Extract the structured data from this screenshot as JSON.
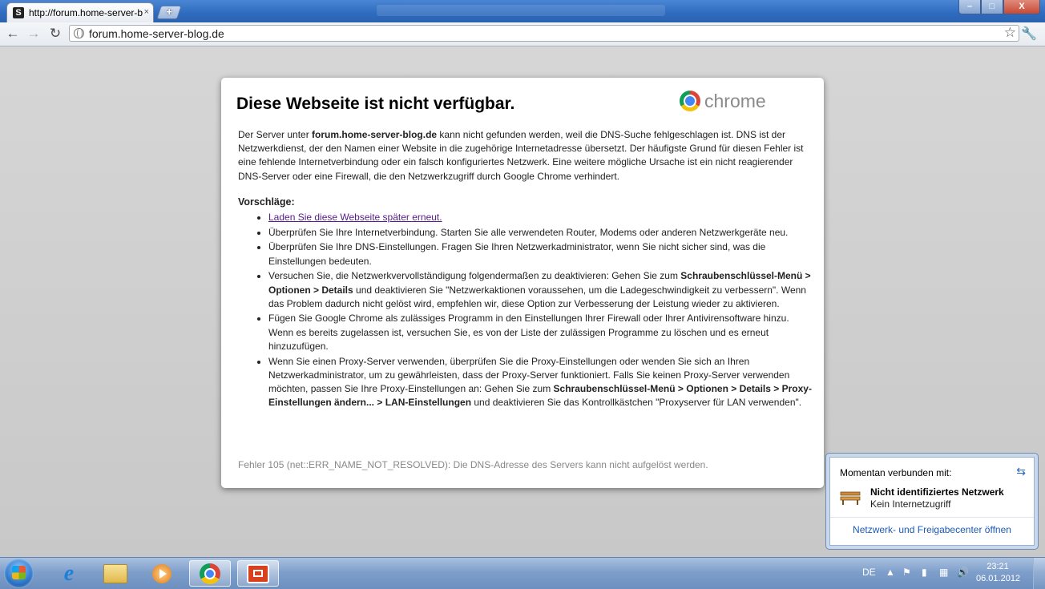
{
  "browser": {
    "tab_title": "http://forum.home-server-blog.de",
    "tab_close": "×",
    "new_tab": "+",
    "window_controls": {
      "minimize": "–",
      "maximize": "□",
      "close": "X"
    },
    "url": "forum.home-server-blog.de",
    "icons": {
      "back": "back-arrow-icon",
      "forward": "forward-arrow-icon",
      "reload": "reload-icon",
      "star": "star-icon",
      "wrench": "wrench-icon"
    }
  },
  "error_page": {
    "title": "Diese Webseite ist nicht verfügbar.",
    "brand": "chrome",
    "intro_prefix": "Der Server unter ",
    "intro_host": "forum.home-server-blog.de",
    "intro_rest": " kann nicht gefunden werden, weil die DNS-Suche fehlgeschlagen ist. DNS ist der Netzwerkdienst, der den Namen einer Website in die zugehörige Internetadresse übersetzt. Der häufigste Grund für diesen Fehler ist eine fehlende Internetverbindung oder ein falsch konfiguriertes Netzwerk. Eine weitere mögliche Ursache ist ein nicht reagierender DNS-Server oder eine Firewall, die den Netzwerkzugriff durch Google Chrome verhindert.",
    "suggestions_title": "Vorschläge:",
    "suggestion_link": "Laden Sie diese Webseite später erneut.",
    "s2": "Überprüfen Sie Ihre Internetverbindung. Starten Sie alle verwendeten Router, Modems oder anderen Netzwerkgeräte neu.",
    "s3": "Überprüfen Sie Ihre DNS-Einstellungen. Fragen Sie Ihren Netzwerkadministrator, wenn Sie nicht sicher sind, was die Einstellungen bedeuten.",
    "s4_a": "Versuchen Sie, die Netzwerkvervollständigung folgendermaßen zu deaktivieren: Gehen Sie zum ",
    "s4_b": "Schraubenschlüssel-Menü > Optionen > Details",
    "s4_c": " und deaktivieren Sie \"Netzwerkaktionen voraussehen, um die Ladegeschwindigkeit zu verbessern\". Wenn das Problem dadurch nicht gelöst wird, empfehlen wir, diese Option zur Verbesserung der Leistung wieder zu aktivieren.",
    "s5": "Fügen Sie Google Chrome als zulässiges Programm in den Einstellungen Ihrer Firewall oder Ihrer Antivirensoftware hinzu. Wenn es bereits zugelassen ist, versuchen Sie, es von der Liste der zulässigen Programme zu löschen und es erneut hinzuzufügen.",
    "s6_a": "Wenn Sie einen Proxy-Server verwenden, überprüfen Sie die Proxy-Einstellungen oder wenden Sie sich an Ihren Netzwerkadministrator, um zu gewährleisten, dass der Proxy-Server funktioniert. Falls Sie keinen Proxy-Server verwenden möchten, passen Sie Ihre Proxy-Einstellungen an: Gehen Sie zum ",
    "s6_b": "Schraubenschlüssel-Menü > Optionen > Details > Proxy-Einstellungen ändern... > LAN-Einstellungen",
    "s6_c": " und deaktivieren Sie das Kontrollkästchen \"Proxyserver für LAN verwenden\".",
    "error_code": "Fehler 105 (net::ERR_NAME_NOT_RESOLVED): Die DNS-Adresse des Servers kann nicht aufgelöst werden."
  },
  "network_popup": {
    "header": "Momentan verbunden mit:",
    "network_name": "Nicht identifiziertes Netzwerk",
    "network_status": "Kein Internetzugriff",
    "link": "Netzwerk- und Freigabecenter öffnen"
  },
  "taskbar": {
    "language": "DE",
    "time": "23:21",
    "date": "06.01.2012",
    "apps": [
      "internet-explorer",
      "windows-explorer",
      "media-player",
      "google-chrome",
      "snagit"
    ]
  }
}
